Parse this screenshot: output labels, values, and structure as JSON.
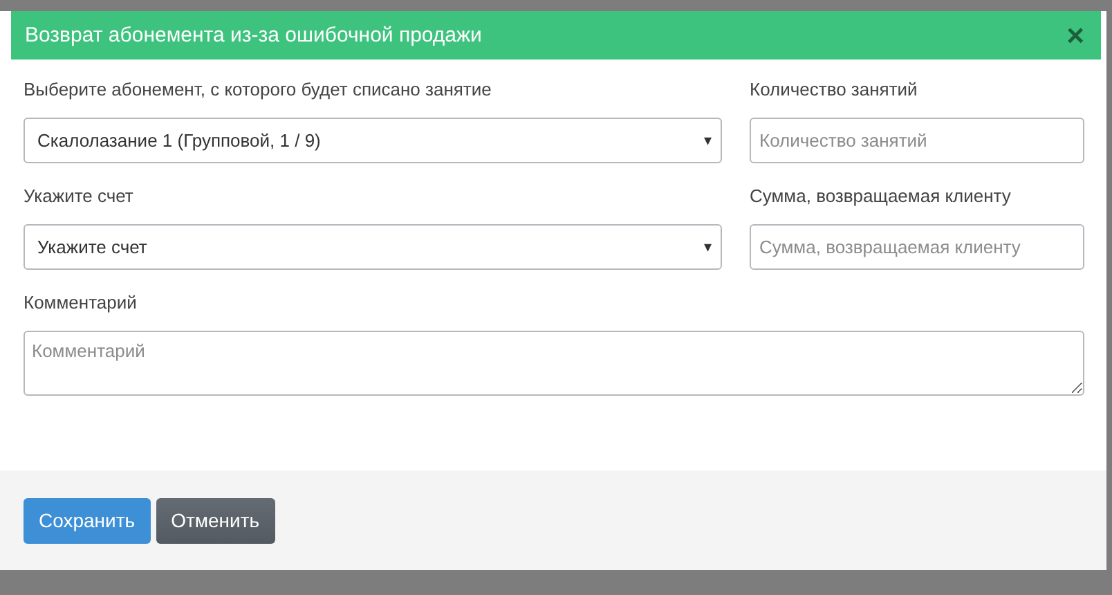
{
  "modal": {
    "title": "Возврат абонемента из-за ошибочной продажи",
    "close": "×",
    "fields": [
      {
        "kind": "select",
        "label": "Выберите абонемент, с которого будет списано занятие",
        "value": "Скалолазание 1 (Групповой, 1 / 9)",
        "caret": "▾"
      },
      {
        "kind": "input",
        "label": "Количество занятий",
        "placeholder": "Количество занятий"
      },
      {
        "kind": "select",
        "label": "Укажите счет",
        "value": "Укажите счет",
        "caret": "▾"
      },
      {
        "kind": "input",
        "label": "Сумма, возвращаемая клиенту",
        "placeholder": "Сумма, возвращаемая клиенту"
      }
    ],
    "comment": {
      "label": "Комментарий",
      "placeholder": "Комментарий"
    },
    "buttons": [
      {
        "label": "Сохранить",
        "kind": "primary"
      },
      {
        "label": "Отменить",
        "kind": "secondary"
      }
    ]
  }
}
